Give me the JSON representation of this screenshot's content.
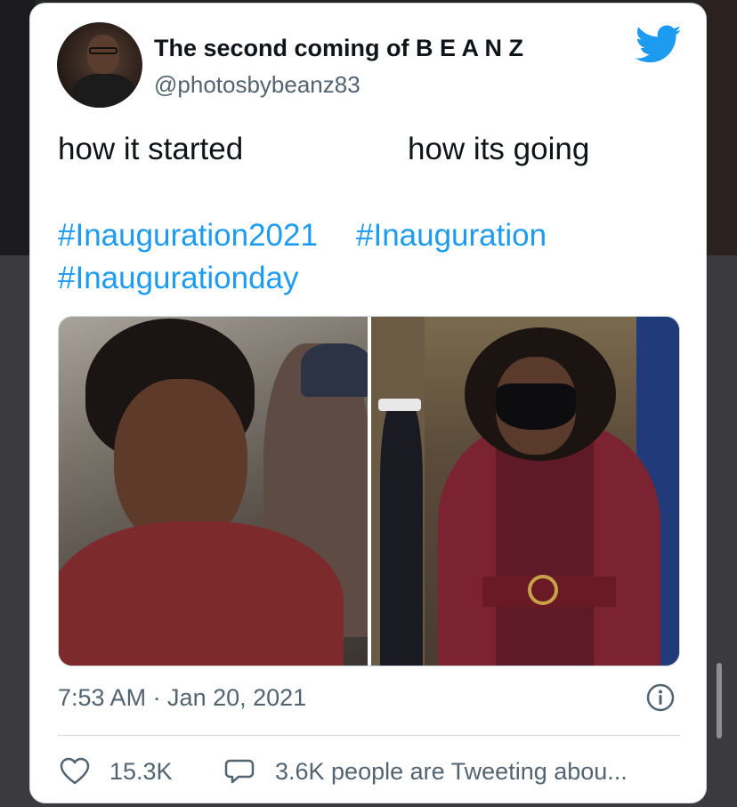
{
  "tweet": {
    "display_name": "The second coming of B E A N Z",
    "handle": "@photosbybeanz83",
    "text_left": "how it started",
    "text_right": "how its going",
    "hashtags": [
      "#Inauguration2021",
      "#Inauguration",
      "#Inaugurationday"
    ],
    "timestamp": "7:53 AM · Jan 20, 2021",
    "likes": "15.3K",
    "tweeting": "3.6K people are Tweeting abou..."
  },
  "icons": {
    "brand": "twitter-bird-icon",
    "info": "info-icon",
    "like": "heart-icon",
    "reply": "speech-bubble-icon"
  },
  "colors": {
    "brand": "#1d9bf0",
    "text": "#0f1419",
    "secondary": "#536471"
  }
}
